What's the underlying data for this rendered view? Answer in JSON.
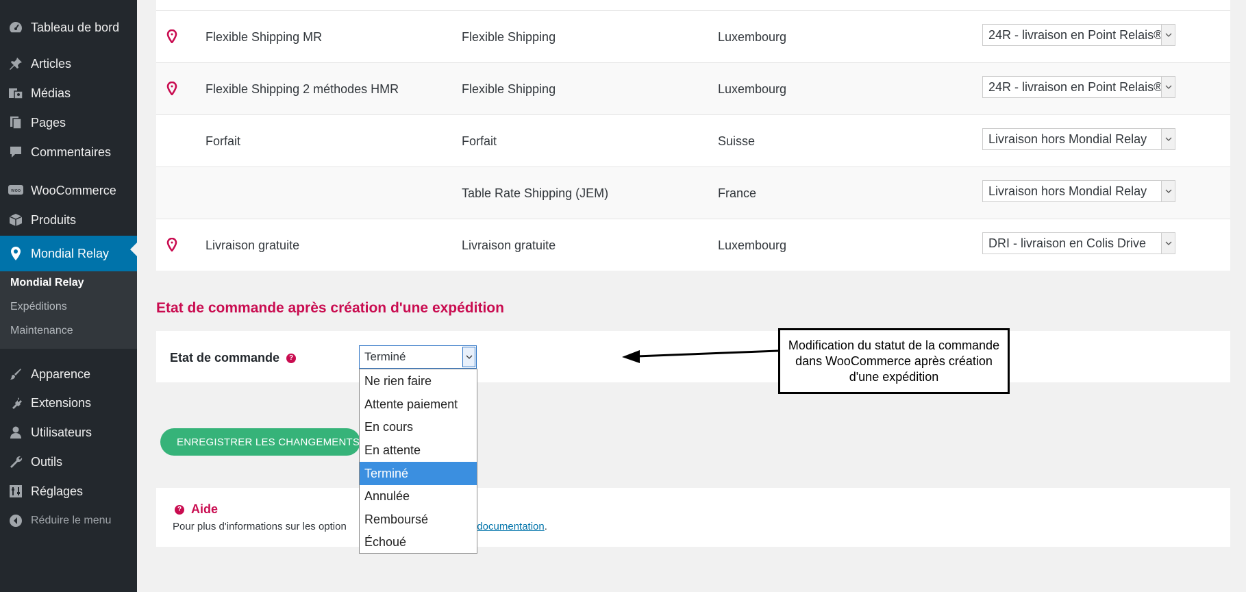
{
  "sidebar": {
    "items": [
      {
        "label": "Tableau de bord",
        "icon": "dashboard-icon"
      },
      {
        "label": "Articles",
        "icon": "pin-icon"
      },
      {
        "label": "Médias",
        "icon": "media-icon"
      },
      {
        "label": "Pages",
        "icon": "pages-icon"
      },
      {
        "label": "Commentaires",
        "icon": "comments-icon"
      },
      {
        "label": "WooCommerce",
        "icon": "woocommerce-icon"
      },
      {
        "label": "Produits",
        "icon": "products-icon"
      },
      {
        "label": "Mondial Relay",
        "icon": "location-pin-icon",
        "active": true
      },
      {
        "label": "Apparence",
        "icon": "appearance-icon"
      },
      {
        "label": "Extensions",
        "icon": "plugins-icon"
      },
      {
        "label": "Utilisateurs",
        "icon": "users-icon"
      },
      {
        "label": "Outils",
        "icon": "tools-icon"
      },
      {
        "label": "Réglages",
        "icon": "settings-icon"
      }
    ],
    "submenu": [
      {
        "label": "Mondial Relay",
        "current": true
      },
      {
        "label": "Expéditions"
      },
      {
        "label": "Maintenance"
      }
    ],
    "collapse_label": "Réduire le menu"
  },
  "shipping_rows": [
    {
      "has_pin": true,
      "name": "Flexible Shipping MR",
      "method": "Flexible Shipping",
      "zone": "Luxembourg",
      "service": "24R - livraison en Point Relais®"
    },
    {
      "has_pin": true,
      "name": "Flexible Shipping 2 méthodes HMR",
      "method": "Flexible Shipping",
      "zone": "Luxembourg",
      "service": "24R - livraison en Point Relais®"
    },
    {
      "has_pin": false,
      "name": "Forfait",
      "method": "Forfait",
      "zone": "Suisse",
      "service": "Livraison hors Mondial Relay"
    },
    {
      "has_pin": false,
      "name": "",
      "method": "Table Rate Shipping (JEM)",
      "zone": "France",
      "service": "Livraison hors Mondial Relay"
    },
    {
      "has_pin": true,
      "name": "Livraison gratuite",
      "method": "Livraison gratuite",
      "zone": "Luxembourg",
      "service": "DRI - livraison en Colis Drive"
    }
  ],
  "order_status": {
    "section_title": "Etat de commande après création d'une expédition",
    "label": "Etat de commande",
    "selected": "Terminé",
    "options": [
      "Ne rien faire",
      "Attente paiement",
      "En cours",
      "En attente",
      "Terminé",
      "Annulée",
      "Remboursé",
      "Échoué"
    ],
    "selected_index": 4
  },
  "save_button_label": "ENREGISTRER LES CHANGEMENTS",
  "help": {
    "title": "Aide",
    "text_prefix": "Pour plus d'informations sur les option",
    "link_text": "a documentation",
    "text_suffix": "."
  },
  "callout": {
    "text": "Modification du statut de la commande dans WooCommerce après création d'une expédition"
  },
  "colors": {
    "sidebar_bg": "#23282d",
    "active_menu": "#0073aa",
    "accent": "#c90c50",
    "save_button": "#36b379",
    "selected_option": "#3b8fe0"
  }
}
